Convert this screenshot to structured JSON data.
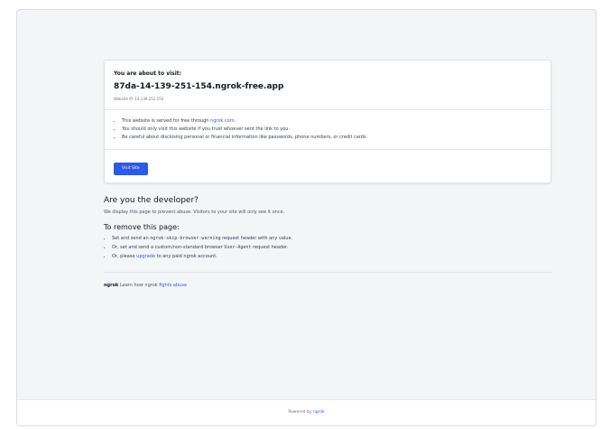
{
  "card": {
    "kicker": "You are about to visit:",
    "host": "87da-14-139-251-154.ngrok-free.app",
    "ip": "Website IP: 14.139.251.154",
    "bullets": {
      "b1_prefix": "This website is served for free through ",
      "b1_link": "ngrok.com",
      "b1_suffix": ".",
      "b2": "You should only visit this website if you trust whoever sent the link to you.",
      "b3": "Be careful about disclosing personal or financial information like passwords, phone numbers, or credit cards."
    },
    "button_label": "Visit Site"
  },
  "developer": {
    "title": "Are you the developer?",
    "text": "We display this page to prevent abuse. Visitors to your site will only see it once."
  },
  "remove": {
    "title": "To remove this page:",
    "i1_prefix": "Set and send an ",
    "i1_code": "ngrok-skip-browser-warning",
    "i1_suffix": " request header with any value.",
    "i2_prefix": "Or, set and send a custom/non-standard browser ",
    "i2_code": "User-Agent",
    "i2_suffix": " request header.",
    "i3_prefix": "Or, please ",
    "i3_link": "upgrade",
    "i3_suffix": " to any paid ngrok account."
  },
  "brand": {
    "name": "ngrok",
    "text": " Learn how ngrok ",
    "link": "fights abuse"
  },
  "footer": {
    "prefix": "Powered by ",
    "link": "ngrok"
  },
  "colors": {
    "accent": "#2b59e8",
    "link": "#2563eb",
    "background": "#f4f5f7"
  }
}
